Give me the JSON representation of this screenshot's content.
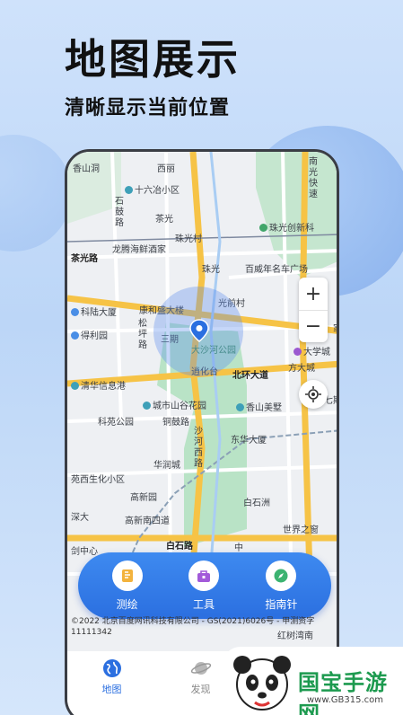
{
  "hero": {
    "title": "地图展示",
    "subtitle": "清晰显示当前位置"
  },
  "map": {
    "labels": {
      "xianshan": "香山洞",
      "xiliu": "西丽",
      "shiliuye": "十六冶小区",
      "shigu": "石鼓路",
      "chaguang": "茶光",
      "zhuguangcun": "珠光村",
      "zhuguangcx": "珠光创新科",
      "longteng": "龙腾海鲜酒家",
      "chaguanglu": "茶光路",
      "zhuguang": "珠光",
      "baiwei": "百威年名车广场",
      "kangheying": "康和盛大楼",
      "guangqiancun": "光前村",
      "kejilou": "科陆大厦",
      "deliyuan": "得利园",
      "songpinglu": "松坪路",
      "sanqi": "三期",
      "park": "大沙河公园",
      "daxuecheng": "大学城",
      "fangda": "方大城",
      "nanguang": "南光快速",
      "beihuan": "北环大道",
      "tuanzongdao": "逍化台",
      "qinghua": "清华信息港",
      "chengshi": "城市山谷花园",
      "xiangshan": "香山美墅",
      "kehua": "科苑公园",
      "tongyulu": "铜鼓路",
      "dongfa": "东华大厦",
      "huarun": "华润城",
      "shahexilu": "沙河西路",
      "keyuan": "苑西生化小区",
      "gaoxin": "高新园",
      "baishizhou": "白石洲",
      "shenda": "深大",
      "gaoxinnan": "高新南四道",
      "shijie": "世界之窗",
      "zhongxin": "剑中心",
      "baishilu": "白石路",
      "shen": "中",
      "hongshu": "红树湾南",
      "qi": "七期",
      "xinjia": "家"
    },
    "zoom_in": "+",
    "zoom_out": "−",
    "copyright": "©2022 北京百度网讯科技有限公司 - GS(2021)6026号 - 甲测资字11111342"
  },
  "tools": [
    {
      "label": "测绘",
      "icon": "ruler-icon"
    },
    {
      "label": "工具",
      "icon": "toolbox-icon"
    },
    {
      "label": "指南针",
      "icon": "compass-icon"
    }
  ],
  "tabs": [
    {
      "label": "地图",
      "icon": "globe-icon"
    },
    {
      "label": "发现",
      "icon": "planet-icon"
    }
  ],
  "watermark": {
    "name": "国宝手游网",
    "url": "www.GB315.com"
  },
  "colors": {
    "accent": "#2b6fe0",
    "road_major": "#f6c346",
    "park": "#b9e3c6"
  }
}
